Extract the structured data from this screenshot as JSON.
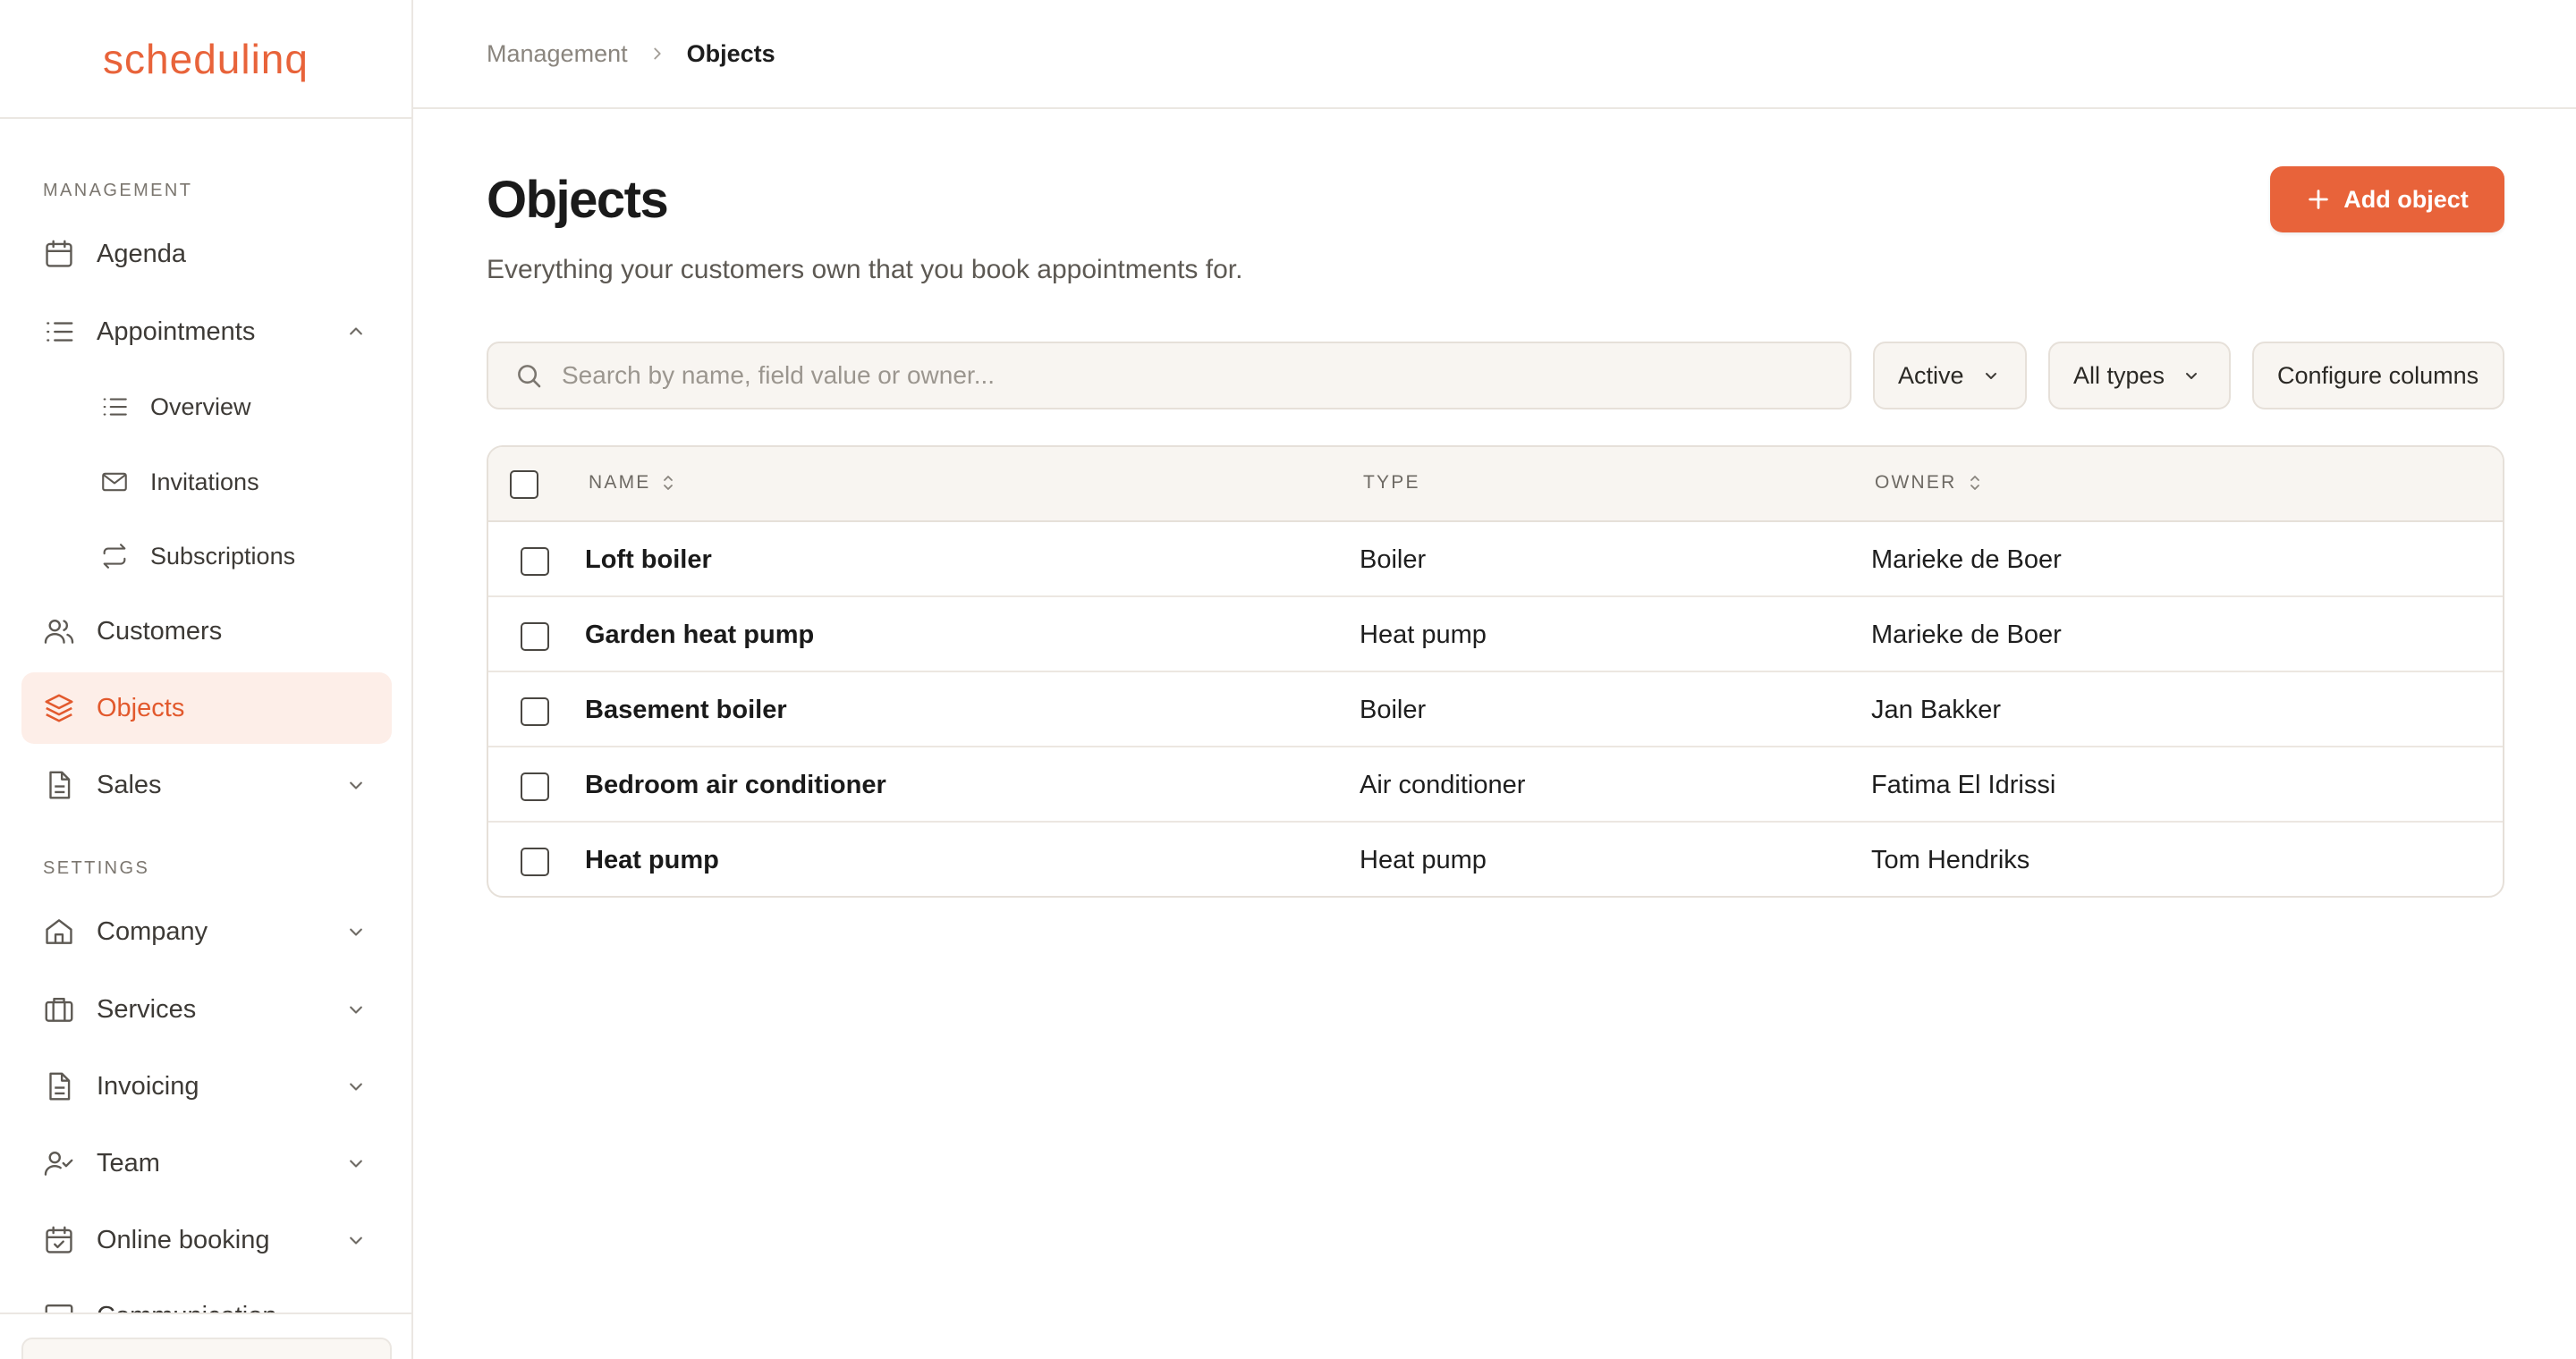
{
  "brand": {
    "logo_text": "schedulinq",
    "accent": "#e8633a"
  },
  "sidebar": {
    "section_management": "MANAGEMENT",
    "section_settings": "SETTINGS",
    "items": {
      "agenda": "Agenda",
      "appointments": "Appointments",
      "overview": "Overview",
      "invitations": "Invitations",
      "subscriptions": "Subscriptions",
      "customers": "Customers",
      "objects": "Objects",
      "sales": "Sales",
      "company": "Company",
      "services": "Services",
      "invoicing": "Invoicing",
      "team": "Team",
      "online_booking": "Online booking",
      "communication": "Communication"
    }
  },
  "breadcrumb": {
    "parent": "Management",
    "current": "Objects"
  },
  "page": {
    "title": "Objects",
    "subtitle": "Everything your customers own that you book appointments for.",
    "add_button": "Add object"
  },
  "toolbar": {
    "search_placeholder": "Search by name, field value or owner...",
    "status_filter": "Active",
    "type_filter": "All types",
    "configure_columns": "Configure columns"
  },
  "table": {
    "headers": {
      "name": "NAME",
      "type": "TYPE",
      "owner": "OWNER"
    },
    "rows": [
      {
        "name": "Loft boiler",
        "type": "Boiler",
        "owner": "Marieke de Boer"
      },
      {
        "name": "Garden heat pump",
        "type": "Heat pump",
        "owner": "Marieke de Boer"
      },
      {
        "name": "Basement boiler",
        "type": "Boiler",
        "owner": "Jan Bakker"
      },
      {
        "name": "Bedroom air conditioner",
        "type": "Air conditioner",
        "owner": "Fatima El Idrissi"
      },
      {
        "name": "Heat pump",
        "type": "Heat pump",
        "owner": "Tom Hendriks"
      }
    ]
  }
}
